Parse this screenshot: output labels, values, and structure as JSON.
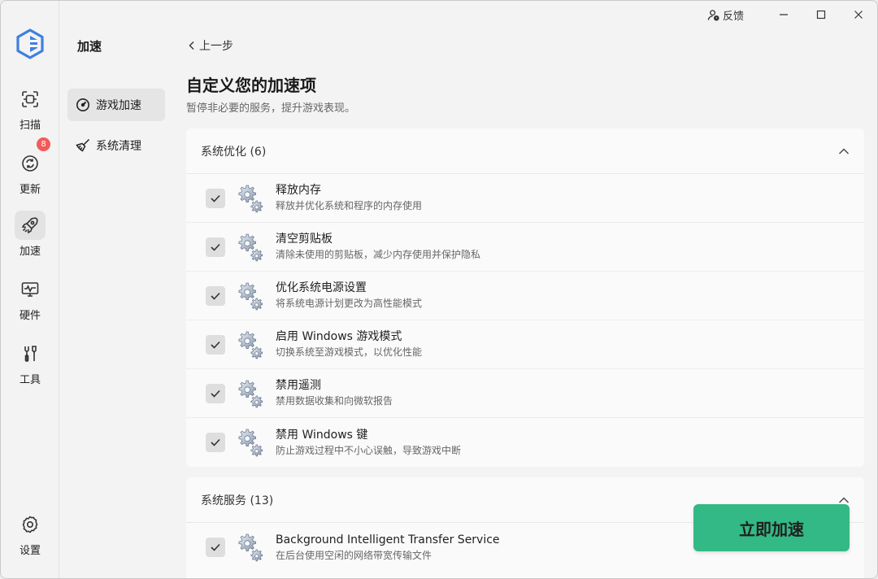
{
  "titlebar": {
    "feedback_label": "反馈"
  },
  "rail": {
    "items": [
      {
        "label": "扫描",
        "icon": "scan-icon"
      },
      {
        "label": "更新",
        "icon": "update-icon",
        "badge": "8"
      },
      {
        "label": "加速",
        "icon": "rocket-icon",
        "active": true
      },
      {
        "label": "硬件",
        "icon": "hardware-monitor-icon"
      },
      {
        "label": "工具",
        "icon": "tools-icon"
      }
    ],
    "settings_label": "设置"
  },
  "subnav": {
    "title": "加速",
    "items": [
      {
        "label": "游戏加速",
        "icon": "gauge-icon",
        "active": true
      },
      {
        "label": "系统清理",
        "icon": "broom-icon"
      }
    ]
  },
  "main": {
    "back_label": "上一步",
    "title": "自定义您的加速项",
    "subtitle": "暂停非必要的服务，提升游戏表现。",
    "groups": [
      {
        "title": "系统优化 (6)",
        "items": [
          {
            "title": "释放内存",
            "desc": "释放并优化系统和程序的内存使用",
            "checked": true
          },
          {
            "title": "清空剪贴板",
            "desc": "清除未使用的剪贴板，减少内存使用并保护隐私",
            "checked": true
          },
          {
            "title": "优化系统电源设置",
            "desc": "将系统电源计划更改为高性能模式",
            "checked": true
          },
          {
            "title": "启用 Windows 游戏模式",
            "desc": "切换系统至游戏模式，以优化性能",
            "checked": true
          },
          {
            "title": "禁用遥测",
            "desc": "禁用数据收集和向微软报告",
            "checked": true
          },
          {
            "title": "禁用 Windows 键",
            "desc": "防止游戏过程中不小心误触，导致游戏中断",
            "checked": true
          }
        ]
      },
      {
        "title": "系统服务 (13)",
        "items": [
          {
            "title": "Background Intelligent Transfer Service",
            "desc": "在后台使用空闲的网络带宽传输文件",
            "checked": true
          }
        ]
      }
    ],
    "action_label": "立即加速"
  },
  "colors": {
    "accent_green": "#33b985",
    "badge_red": "#f25b5b",
    "logo_blue": "#3f7fe0"
  }
}
